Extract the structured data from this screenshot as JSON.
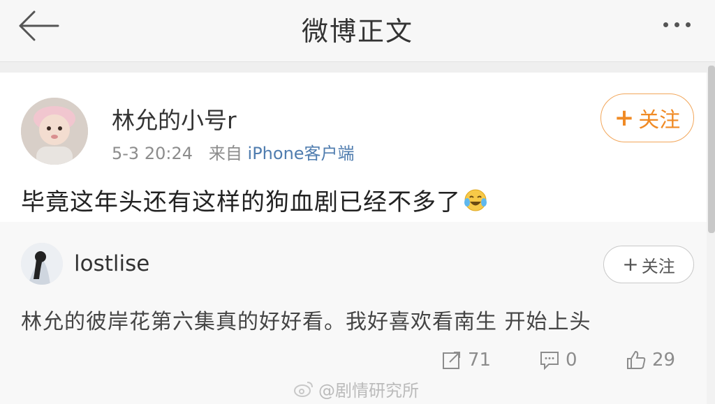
{
  "nav": {
    "title": "微博正文",
    "back_icon": "back-arrow-icon",
    "more_icon": "more-icon"
  },
  "post": {
    "author": "林允的小号r",
    "time": "5-3 20:24",
    "source_prefix": "来自",
    "source": "iPhone客户端",
    "follow_label": "关注",
    "text": "毕竟这年头还有这样的狗血剧已经不多了",
    "emoji": "laugh-cry-emoji"
  },
  "comment": {
    "author": "lostlise",
    "follow_label": "关注",
    "text": "林允的彼岸花第六集真的好好看。我好喜欢看南生 开始上头"
  },
  "actions": {
    "repost_count": "71",
    "comment_count": "0",
    "like_count": "29"
  },
  "watermark": "@剧情研究所",
  "colors": {
    "accent_orange": "#f08a24",
    "link_blue": "#507daf"
  }
}
